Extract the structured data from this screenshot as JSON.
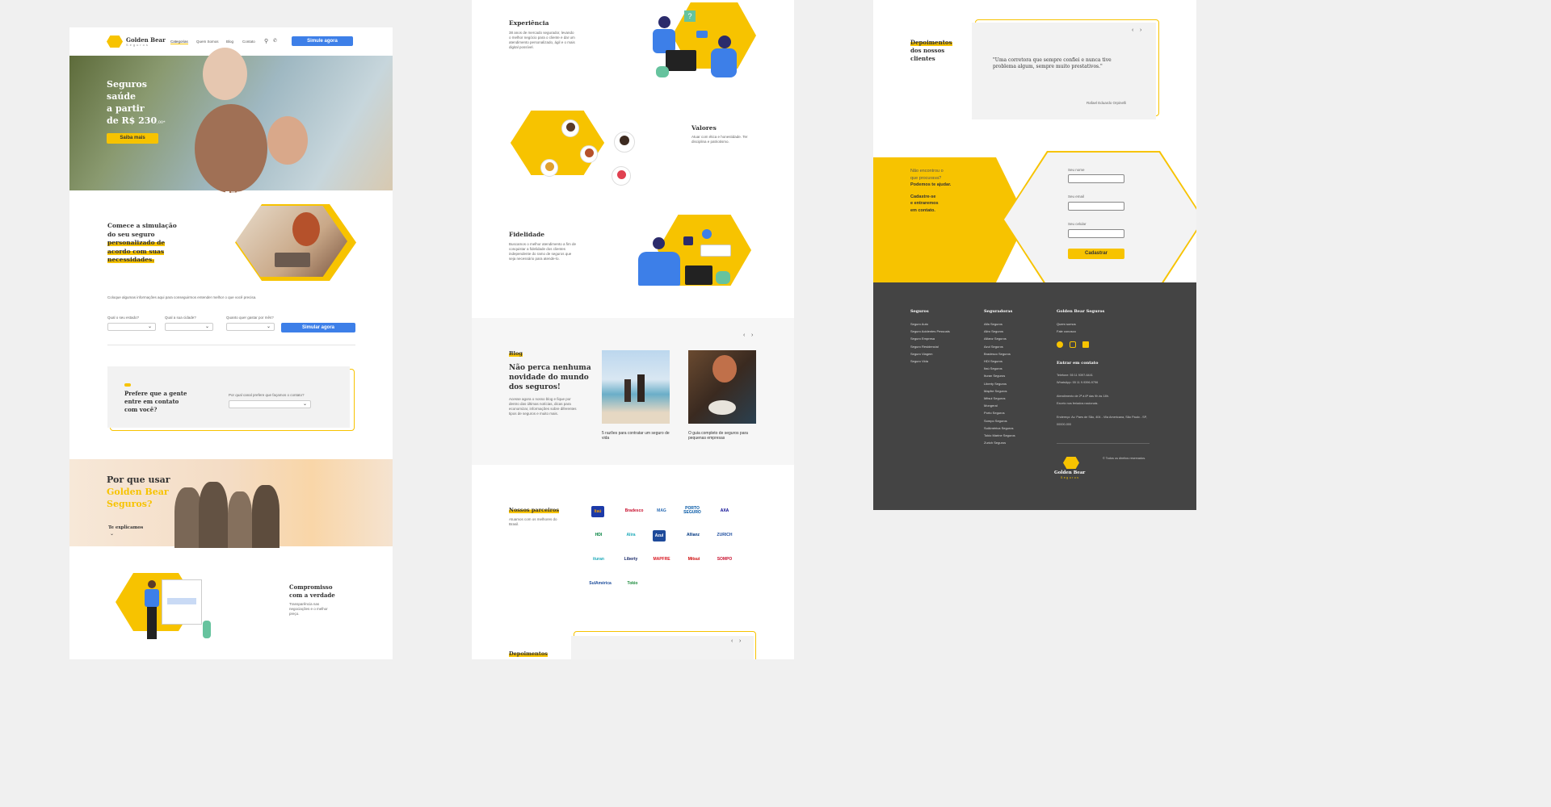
{
  "brand": {
    "name": "Golden Bear",
    "sub": "Seguros"
  },
  "nav": {
    "items": [
      "Categorias",
      "Quem Somos",
      "Blog",
      "Contato"
    ],
    "cta": "Simule agora"
  },
  "hero": {
    "l1": "Seguros",
    "l2": "saúde",
    "l3": "a partir",
    "l4": "de R$ 230",
    "suffix": ",00*",
    "cta": "Saiba mais"
  },
  "simulation": {
    "t1": "Comece a simulação",
    "t2": "do seu seguro",
    "t3": "personalizado de",
    "t4": "acordo com suas",
    "t5": "necessidades.",
    "note": "Coloque algumas informações aqui para conseguirmos entender melhor o que você precisa.",
    "state_label": "Qual o seu estado?",
    "city_label": "Qual a sua cidade?",
    "price_label": "Quanto quer gastar por mês?",
    "cta": "Simular agora"
  },
  "contact_pref": {
    "l1": "Prefere que a gente",
    "l2": "entre em contato",
    "l3": "com você?",
    "question": "Por qual canal prefere que façamos o contato?"
  },
  "why": {
    "l1": "Por que usar",
    "l2": "Golden Bear",
    "l3": "Seguros?",
    "link": "Te explicamos"
  },
  "commitment": {
    "title1": "Compromisso",
    "title2": "com a verdade",
    "text": "Transparência nas negociações e o melhor preço."
  },
  "experience": {
    "title": "Experiência",
    "text": "38 anos de mercado segurador, levando o melhor negócio para o cliente e dar um atendimento personalizado, ágil e o mais digital possível."
  },
  "values": {
    "title": "Valores",
    "text": "Atuar com ética e honestidade. Ter disciplina e patriotismo."
  },
  "loyalty": {
    "title": "Fidelidade",
    "text": "Buscamos o melhor atendimento a fim de conquistar a fidelidade dos clientes independente do ramo de seguros que seja necessário para atende-lo."
  },
  "blog": {
    "tag": "Blog",
    "t1": "Não perca nenhuma",
    "t2": "novidade do mundo",
    "t3": "dos seguros!",
    "text": "Acesse agora o nosso blog e fique por dentro das últimas notícias, dicas para economizar, informações sobre diferentes tipos de seguros e muito mais.",
    "posts": [
      "5 razões para contratar um seguro de vida",
      "O guia completo de seguros para pequenas empresas"
    ]
  },
  "partners": {
    "title": "Nossos parceiros",
    "text": "Atuamos com os melhores do Brasil.",
    "logos": [
      "Itaú",
      "Bradesco",
      "MAG",
      "PORTO SEGURO",
      "AXA",
      "HDI",
      "Alira",
      "Azul",
      "Allianz",
      "ZURICH",
      "ituran",
      "Liberty",
      "MAPFRE",
      "Mitsui",
      "SOMPO",
      "SulAmérica",
      "Tokio"
    ]
  },
  "testimonials": {
    "title1": "Depoimentos",
    "title2": "dos nossos",
    "title3": "clientes",
    "quote": "\"Uma corretora que sempre confiei e nunca tive problema algum, sempre muito prestativos.\"",
    "author": "Rafael Eduardo Orpinelli"
  },
  "signup": {
    "l1": "Não encontrou o",
    "l2": "que procurava?",
    "l3": "Podemos te ajudar.",
    "l4": "Cadastre-se",
    "l5": "e entraremos",
    "l6": "em contato.",
    "f1": "Seu nome",
    "f2": "Seu email",
    "f3": "Seu celular",
    "cta": "Cadastrar"
  },
  "footer": {
    "col1_title": "Seguros",
    "col1": [
      "Seguro Auto",
      "Seguro Acidentes Pessoais",
      "Seguro Empresa",
      "Seguro Residencial",
      "Seguro Viagem",
      "Seguro Vida"
    ],
    "col2_title": "Seguradoras",
    "col2": [
      "Alfa Seguros",
      "Aliro Seguros",
      "Allianz Seguros",
      "Azul Seguros",
      "Bradesco Seguros",
      "HDI Seguros",
      "Itaú Seguros",
      "Ituran Seguros",
      "Liberty Seguros",
      "Mapfre Seguros",
      "Mitsui Seguros",
      "Mongeral",
      "Porto Seguros",
      "Sompo Seguros",
      "SulAmérica Seguros",
      "Tokio Marine Seguros",
      "Zurich Seguros"
    ],
    "col3_title": "Golden Bear Seguros",
    "col3": [
      "Quem somos",
      "Fale conosco"
    ],
    "contact_title": "Entrar em contato",
    "phone": "Telefone: 55 11 9397-6441",
    "whats": "WhatsApp: 55 11 9.9396-9796",
    "hours": "Atendimento de 2ª à 6ª das 9h às 18h.",
    "hours2": "Exceto nos feriados nacionais.",
    "address": "Endereço: Av. Paes de São, 404 - Vila Americana, São Paulo - SP, 00000-000",
    "copy": "© Todos os direitos reservados."
  }
}
